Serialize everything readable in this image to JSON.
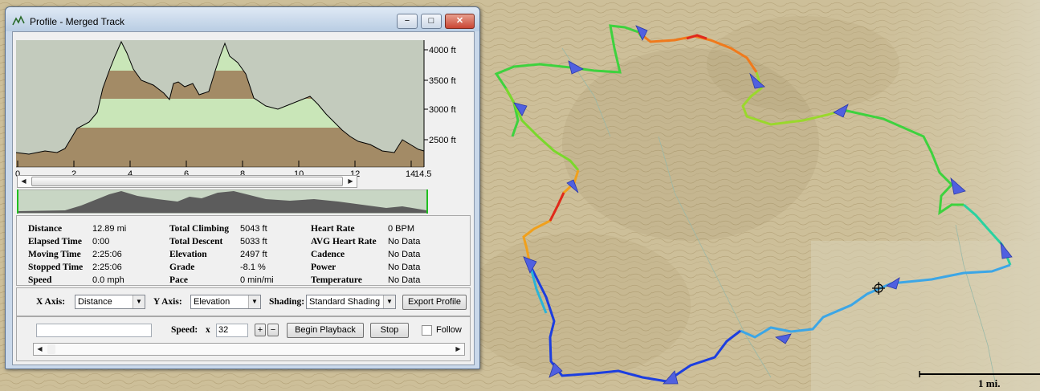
{
  "window": {
    "title": "Profile - Merged Track",
    "minimize_glyph": "−",
    "maximize_glyph": "□",
    "close_glyph": "✕",
    "icon": "profile-track-icon"
  },
  "profile": {
    "y_ticks": [
      "4000 ft",
      "3500 ft",
      "3000 ft",
      "2500 ft"
    ],
    "x_ticks": [
      "0",
      "2",
      "4",
      "6",
      "8",
      "10",
      "12",
      "14",
      "14.5"
    ],
    "colors": {
      "band_brown": "#a38b66",
      "band_green": "#c9e6b8",
      "background": "#c3cbbd",
      "mini_fill": "#5c5c5c",
      "mini_bg": "#c8d6c4"
    }
  },
  "stats": {
    "col1": [
      {
        "label": "Distance",
        "value": "12.89 mi"
      },
      {
        "label": "Elapsed Time",
        "value": "0:00"
      },
      {
        "label": "Moving Time",
        "value": "2:25:06"
      },
      {
        "label": "Stopped Time",
        "value": "2:25:06"
      },
      {
        "label": "Speed",
        "value": "0.0 mph"
      }
    ],
    "col2": [
      {
        "label": "Total Climbing",
        "value": "5043 ft"
      },
      {
        "label": "Total Descent",
        "value": "5033 ft"
      },
      {
        "label": "Elevation",
        "value": "2497 ft"
      },
      {
        "label": "Grade",
        "value": "-8.1 %"
      },
      {
        "label": "Pace",
        "value": "0 min/mi"
      }
    ],
    "col3": [
      {
        "label": "Heart Rate",
        "value": "0 BPM"
      },
      {
        "label": "AVG Heart Rate",
        "value": "No Data"
      },
      {
        "label": "Cadence",
        "value": "No Data"
      },
      {
        "label": "Power",
        "value": "No Data"
      },
      {
        "label": "Temperature",
        "value": "No Data"
      }
    ]
  },
  "axes": {
    "x_axis_label": "X Axis:",
    "x_axis_value": "Distance",
    "y_axis_label": "Y Axis:",
    "y_axis_value": "Elevation",
    "shading_label": "Shading:",
    "shading_value": "Standard Shading",
    "export_button": "Export Profile"
  },
  "playback": {
    "name_field_value": "",
    "speed_label": "Speed:",
    "multiplier_label": "x",
    "speed_value": "32",
    "plus_label": "+",
    "minus_label": "−",
    "begin_button": "Begin Playback",
    "stop_button": "Stop",
    "follow_label": "Follow",
    "follow_checked": false
  },
  "map": {
    "scale_label": "1 mi."
  }
}
